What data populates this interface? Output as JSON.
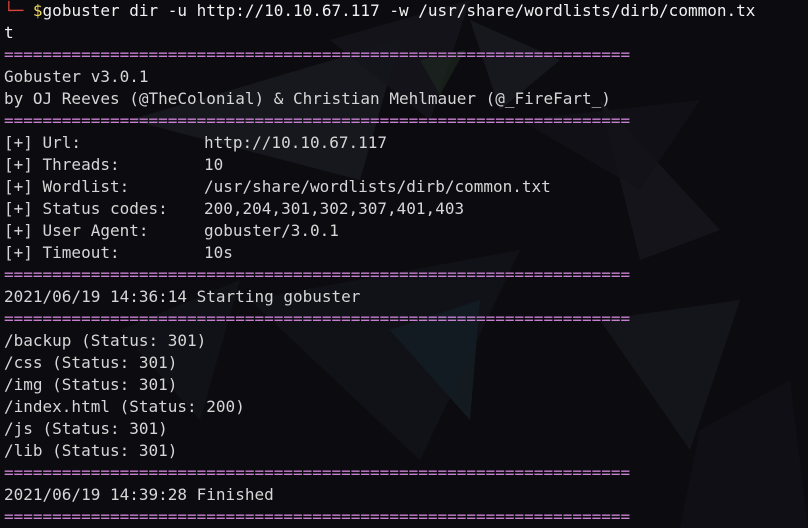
{
  "prompt": {
    "corner": "└─",
    "sign": "$",
    "command": "gobuster dir -u http://10.10.67.117 -w /usr/share/wordlists/dirb/common.tx",
    "command_wrap": "t"
  },
  "separator": "=================================================================",
  "banner": {
    "title": "Gobuster v3.0.1",
    "credits": "by OJ Reeves (@TheColonial) & Christian Mehlmauer (@_FireFart_)"
  },
  "config": [
    {
      "key": "[+] Url:",
      "value": "http://10.10.67.117"
    },
    {
      "key": "[+] Threads:",
      "value": "10"
    },
    {
      "key": "[+] Wordlist:",
      "value": "/usr/share/wordlists/dirb/common.txt"
    },
    {
      "key": "[+] Status codes:",
      "value": "200,204,301,302,307,401,403"
    },
    {
      "key": "[+] User Agent:",
      "value": "gobuster/3.0.1"
    },
    {
      "key": "[+] Timeout:",
      "value": "10s"
    }
  ],
  "start_message": "2021/06/19 14:36:14 Starting gobuster",
  "results": [
    "/backup (Status: 301)",
    "/css (Status: 301)",
    "/img (Status: 301)",
    "/index.html (Status: 200)",
    "/js (Status: 301)",
    "/lib (Status: 301)"
  ],
  "finish_message": "2021/06/19 14:39:28 Finished",
  "colors": {
    "background": "#0c0c10",
    "text": "#d6d6d6",
    "separator": "#c77fd0",
    "prompt_corner": "#e0443d",
    "prompt_sign": "#f0d85a"
  }
}
